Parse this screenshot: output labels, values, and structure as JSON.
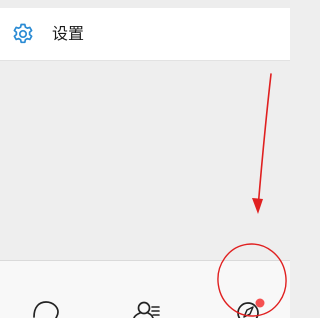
{
  "settings": {
    "label": "设置",
    "icon": "gear-icon",
    "accent_color": "#2a8bd4"
  },
  "tab_bar": {
    "tabs": [
      {
        "name": "chat",
        "icon": "chat-bubble-icon"
      },
      {
        "name": "contacts",
        "icon": "contacts-icon"
      },
      {
        "name": "discover",
        "icon": "compass-icon",
        "has_badge": true
      }
    ],
    "badge_color": "#f55050"
  },
  "annotation": {
    "color": "#e02020"
  }
}
